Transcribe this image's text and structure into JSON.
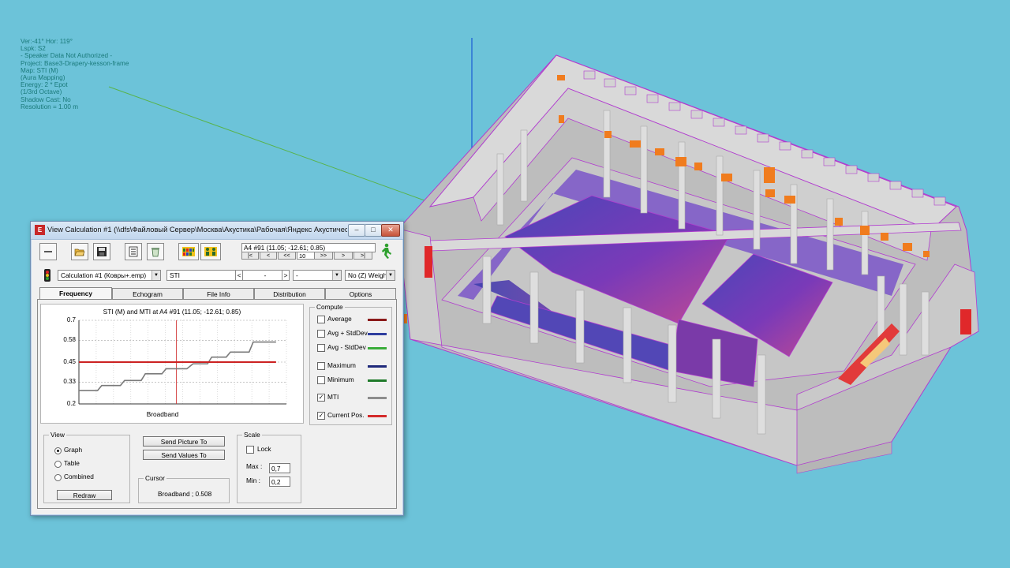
{
  "overlay": {
    "lines": [
      "Ver:-41°  Hor: 119°",
      "Lspk: S2",
      "- Speaker Data Not Authorized -",
      "Project: Base3-Drapery-kesson-frame",
      "Map: STI (M)",
      "(Aura Mapping)",
      "Energy: 2 * Epot",
      "(1/3rd Octave)",
      "Shadow Cast: No",
      "Resolution =   1.00 m"
    ]
  },
  "window": {
    "title": "View Calculation #1 (\\\\dfs\\Файловый Сервер\\Москва\\Акустика\\Рабочая\\Яндекс Акустически...",
    "app_icon": "EASE",
    "controls": {
      "minimize": "–",
      "maximize": "□",
      "close": "✕"
    }
  },
  "toolbar": {
    "icons": [
      "dash-icon",
      "folder-open-icon",
      "save-icon",
      "report-icon",
      "recycle-icon",
      "map-grid-icon",
      "persons-icon"
    ],
    "position_label": "A4 #91  (11.05; -12.61; 0.85)",
    "nav": {
      "first": "|<",
      "prev": "<",
      "prev_fast": "<<",
      "step": "10",
      "next_fast": ">>",
      "next": ">",
      "last": ">|"
    }
  },
  "selectors": {
    "calculation": "Calculation #1 (Ковры+.emp)",
    "parameter": "STI",
    "prev": "<",
    "value": "-",
    "next": ">",
    "band": "-",
    "weighting": "No (Z) Weigh"
  },
  "tabs": [
    {
      "label": "Frequency",
      "active": true
    },
    {
      "label": "Echogram",
      "active": false
    },
    {
      "label": "File Info",
      "active": false
    },
    {
      "label": "Distribution",
      "active": false
    },
    {
      "label": "Options",
      "active": false
    }
  ],
  "chart_data": {
    "type": "line",
    "title": "STI (M) and MTI at A4 #91  (11.05; -12.61; 0.85)",
    "xlabel": "Broadband",
    "ylabel": "",
    "y_ticks": [
      "0.7",
      "0.58",
      "0.45",
      "0.33",
      "0.2"
    ],
    "ylim": [
      0.2,
      0.7
    ],
    "xlim": [
      0,
      1
    ],
    "grid": true,
    "series": [
      {
        "name": "MTI",
        "color": "#7a7a7a",
        "x": [
          0.0,
          0.09,
          0.11,
          0.2,
          0.22,
          0.3,
          0.32,
          0.4,
          0.42,
          0.52,
          0.55,
          0.62,
          0.64,
          0.71,
          0.73,
          0.82,
          0.84,
          0.95
        ],
        "values": [
          0.28,
          0.28,
          0.31,
          0.31,
          0.34,
          0.34,
          0.38,
          0.38,
          0.41,
          0.41,
          0.44,
          0.44,
          0.48,
          0.48,
          0.51,
          0.51,
          0.57,
          0.57
        ]
      },
      {
        "name": "Current Pos.",
        "color": "#cc2222",
        "x": [
          0.0,
          0.95
        ],
        "values": [
          0.45,
          0.45
        ]
      }
    ],
    "cursor_x": 0.47
  },
  "compute": {
    "title": "Compute",
    "items": [
      {
        "label": "Average",
        "checked": false,
        "color": "#8b1a1a"
      },
      {
        "label": "Avg + StdDev",
        "checked": false,
        "color": "#2e3d9e"
      },
      {
        "label": "Avg - StdDev",
        "checked": false,
        "color": "#3aad3a"
      },
      {
        "label": "Maximum",
        "checked": false,
        "color": "#1f2a7a"
      },
      {
        "label": "Minimum",
        "checked": false,
        "color": "#1f7a2a"
      },
      {
        "label": "MTI",
        "checked": true,
        "color": "#8c8c8c"
      },
      {
        "label": "Current Pos.",
        "checked": true,
        "color": "#d42a2a"
      }
    ]
  },
  "view": {
    "title": "View",
    "options": [
      {
        "label": "Graph",
        "selected": true
      },
      {
        "label": "Table",
        "selected": false
      },
      {
        "label": "Combined",
        "selected": false
      }
    ],
    "redraw": "Redraw"
  },
  "send": {
    "picture": "Send Picture To",
    "values": "Send Values To"
  },
  "cursor": {
    "title": "Cursor",
    "value": "Broadband ; 0.508"
  },
  "scale": {
    "title": "Scale",
    "lock": "Lock",
    "max_label": "Max :",
    "max_value": "0,7",
    "min_label": "Min :",
    "min_value": "0,2"
  }
}
